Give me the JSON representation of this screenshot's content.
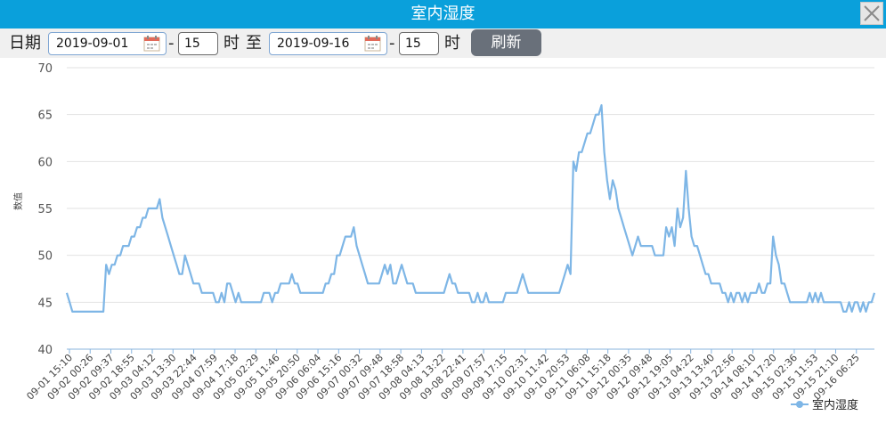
{
  "window": {
    "title": "室内湿度",
    "close_icon": "close-icon"
  },
  "toolbar": {
    "date_label": "日期",
    "start_date": "2019-09-01",
    "dash1": "-",
    "start_hour": "15",
    "hour_label1": "时",
    "to_label": "至",
    "end_date": "2019-09-16",
    "dash2": "-",
    "end_hour": "15",
    "hour_label2": "时",
    "refresh_label": "刷新"
  },
  "colors": {
    "titlebar": "#0aa0db",
    "series": "#7eb6e6",
    "button": "#69707a"
  },
  "chart_data": {
    "type": "line",
    "title": "",
    "xlabel": "",
    "ylabel": "数值",
    "ylim": [
      40,
      70
    ],
    "yticks": [
      40,
      45,
      50,
      55,
      60,
      65,
      70
    ],
    "grid": true,
    "legend_position": "bottom-right",
    "categories": [
      "09-01 15:10",
      "09-02 00:26",
      "09-02 09:37",
      "09-02 18:55",
      "09-03 04:12",
      "09-03 13:30",
      "09-03 22:44",
      "09-04 07:59",
      "09-04 17:18",
      "09-05 02:29",
      "09-05 11:46",
      "09-05 20:50",
      "09-06 06:04",
      "09-06 15:16",
      "09-07 00:32",
      "09-07 09:48",
      "09-07 18:58",
      "09-08 04:13",
      "09-08 13:22",
      "09-08 22:41",
      "09-09 07:57",
      "09-09 17:15",
      "09-10 02:31",
      "09-10 11:42",
      "09-10 20:53",
      "09-11 06:08",
      "09-11 15:18",
      "09-12 00:35",
      "09-12 09:48",
      "09-12 19:05",
      "09-13 04:22",
      "09-13 13:40",
      "09-13 22:56",
      "09-14 08:10",
      "09-14 17:20",
      "09-15 02:36",
      "09-15 11:53",
      "09-15 21:10",
      "09-16 06:25"
    ],
    "series": [
      {
        "name": "室内湿度",
        "values": [
          46,
          45,
          44,
          44,
          44,
          44,
          44,
          44,
          44,
          44,
          44,
          44,
          44,
          44,
          49,
          48,
          49,
          49,
          50,
          50,
          51,
          51,
          51,
          52,
          52,
          53,
          53,
          54,
          54,
          55,
          55,
          55,
          55,
          56,
          54,
          53,
          52,
          51,
          50,
          49,
          48,
          48,
          50,
          49,
          48,
          47,
          47,
          47,
          46,
          46,
          46,
          46,
          46,
          45,
          45,
          46,
          45,
          47,
          47,
          46,
          45,
          46,
          45,
          45,
          45,
          45,
          45,
          45,
          45,
          45,
          46,
          46,
          46,
          45,
          46,
          46,
          47,
          47,
          47,
          47,
          48,
          47,
          47,
          46,
          46,
          46,
          46,
          46,
          46,
          46,
          46,
          46,
          47,
          47,
          48,
          48,
          50,
          50,
          51,
          52,
          52,
          52,
          53,
          51,
          50,
          49,
          48,
          47,
          47,
          47,
          47,
          47,
          48,
          49,
          48,
          49,
          47,
          47,
          48,
          49,
          48,
          47,
          47,
          47,
          46,
          46,
          46,
          46,
          46,
          46,
          46,
          46,
          46,
          46,
          46,
          47,
          48,
          47,
          47,
          46,
          46,
          46,
          46,
          46,
          45,
          45,
          46,
          45,
          45,
          46,
          45,
          45,
          45,
          45,
          45,
          45,
          46,
          46,
          46,
          46,
          46,
          47,
          48,
          47,
          46,
          46,
          46,
          46,
          46,
          46,
          46,
          46,
          46,
          46,
          46,
          46,
          47,
          48,
          49,
          48,
          60,
          59,
          61,
          61,
          62,
          63,
          63,
          64,
          65,
          65,
          66,
          61,
          58,
          56,
          58,
          57,
          55,
          54,
          53,
          52,
          51,
          50,
          51,
          52,
          51,
          51,
          51,
          51,
          51,
          50,
          50,
          50,
          50,
          53,
          52,
          53,
          51,
          55,
          53,
          54,
          59,
          55,
          52,
          51,
          51,
          50,
          49,
          48,
          48,
          47,
          47,
          47,
          47,
          46,
          46,
          45,
          46,
          45,
          46,
          46,
          45,
          46,
          45,
          46,
          46,
          46,
          47,
          46,
          46,
          47,
          47,
          52,
          50,
          49,
          47,
          47,
          46,
          45,
          45,
          45,
          45,
          45,
          45,
          45,
          46,
          45,
          46,
          45,
          46,
          45,
          45,
          45,
          45,
          45,
          45,
          45,
          44,
          44,
          45,
          44,
          45,
          45,
          44,
          45,
          44,
          45,
          45,
          46
        ]
      }
    ]
  }
}
